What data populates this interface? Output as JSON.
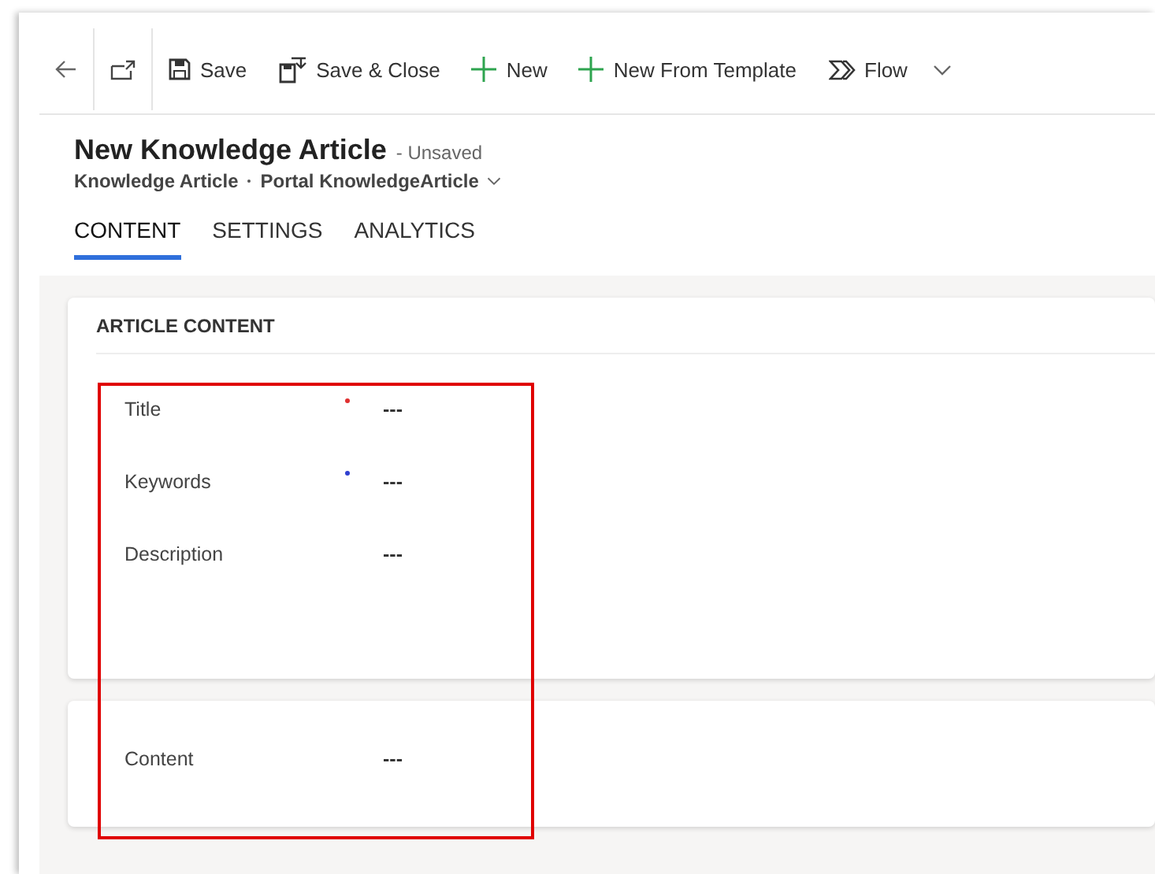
{
  "command_bar": [
    {
      "kind": "back"
    },
    {
      "kind": "popout"
    },
    {
      "kind": "save",
      "label": "Save"
    },
    {
      "kind": "save-close",
      "label": "Save & Close"
    },
    {
      "kind": "new",
      "label": "New"
    },
    {
      "kind": "new",
      "label": "New From Template"
    },
    {
      "kind": "flow",
      "label": "Flow"
    }
  ],
  "header": {
    "title": "New Knowledge Article",
    "status": "- Unsaved",
    "entity": "Knowledge Article",
    "form_name": "Portal KnowledgeArticle"
  },
  "tabs": [
    {
      "label": "CONTENT",
      "selected": true
    },
    {
      "label": "SETTINGS",
      "selected": false
    },
    {
      "label": "ANALYTICS",
      "selected": false
    }
  ],
  "sections": [
    {
      "title": "ARTICLE CONTENT",
      "fields": [
        {
          "label": "Title",
          "kind": "required",
          "value": "---"
        },
        {
          "label": "Keywords",
          "kind": "recommended",
          "value": "---"
        },
        {
          "label": "Description",
          "kind": "plain",
          "value": "---"
        }
      ]
    },
    {
      "fields": [
        {
          "label": "Content",
          "kind": "plain",
          "value": "---"
        }
      ]
    }
  ]
}
